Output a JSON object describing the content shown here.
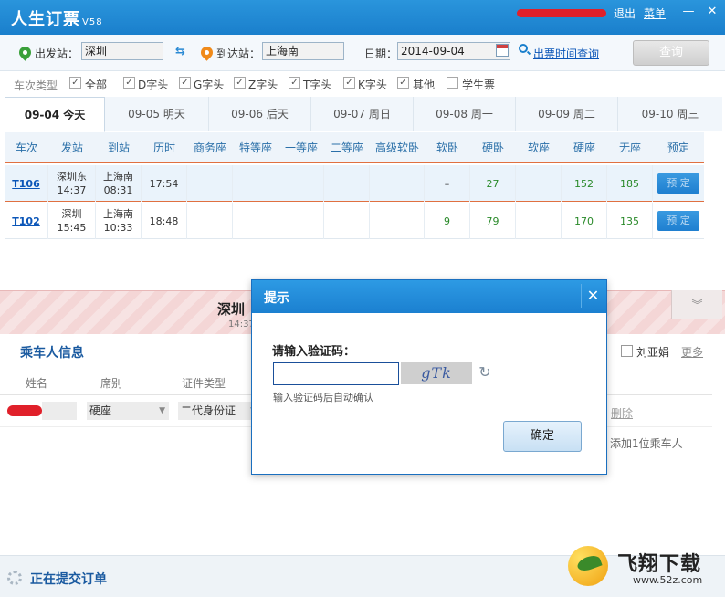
{
  "window": {
    "title": "人生订票",
    "version": "V58",
    "logout_label": "退出",
    "menu_label": "菜单",
    "minimize_glyph": "—",
    "close_glyph": "✕"
  },
  "search": {
    "from_label": "出发站：",
    "from_value": "深圳",
    "swap_glyph": "⇆",
    "to_label": "到达站：",
    "to_value": "上海南",
    "date_label": "日期：",
    "date_value": "2014-09-04",
    "schedule_link": "出票时间查询",
    "query_button": "查询"
  },
  "filters": {
    "label": "车次类型",
    "options": [
      {
        "label": "全部",
        "checked": true
      },
      {
        "label": "D字头",
        "checked": true
      },
      {
        "label": "G字头",
        "checked": true
      },
      {
        "label": "Z字头",
        "checked": true
      },
      {
        "label": "T字头",
        "checked": true
      },
      {
        "label": "K字头",
        "checked": true
      },
      {
        "label": "其他",
        "checked": true
      },
      {
        "label": "学生票",
        "checked": false
      }
    ],
    "check_glyph": "✓"
  },
  "date_tabs": [
    {
      "label": "09-04  今天",
      "active": true
    },
    {
      "label": "09-05  明天",
      "active": false
    },
    {
      "label": "09-06  后天",
      "active": false
    },
    {
      "label": "09-07  周日",
      "active": false
    },
    {
      "label": "09-08  周一",
      "active": false
    },
    {
      "label": "09-09  周二",
      "active": false
    },
    {
      "label": "09-10  周三",
      "active": false
    }
  ],
  "table": {
    "headers": [
      "车次",
      "发站",
      "到站",
      "历时",
      "商务座",
      "特等座",
      "一等座",
      "二等座",
      "高级软卧",
      "软卧",
      "硬卧",
      "软座",
      "硬座",
      "无座",
      "预定"
    ],
    "rows": [
      {
        "train": "T106",
        "from_station": "深圳东",
        "from_time": "14:37",
        "to_station": "上海南",
        "to_time": "08:31",
        "duration": "17:54",
        "business": "",
        "special": "",
        "first": "",
        "second": "",
        "adv_soft_sleeper": "",
        "soft_sleeper": "–",
        "hard_sleeper": "27",
        "soft_seat": "",
        "hard_seat": "152",
        "no_seat": "185",
        "book": "预 定"
      },
      {
        "train": "T102",
        "from_station": "深圳",
        "from_time": "15:45",
        "to_station": "上海南",
        "to_time": "10:33",
        "duration": "18:48",
        "business": "",
        "special": "",
        "first": "",
        "second": "",
        "adv_soft_sleeper": "",
        "soft_sleeper": "9",
        "hard_sleeper": "79",
        "soft_seat": "",
        "hard_seat": "170",
        "no_seat": "135",
        "book": "预 定"
      }
    ]
  },
  "order_panel": {
    "station_text": "深圳",
    "time_text": "14:37",
    "collapse_glyph": "︾",
    "passenger_title": "乘车人信息",
    "saved_passenger": "刘亚娟",
    "more_link": "更多",
    "col_name": "姓名",
    "col_seat": "席别",
    "col_id_type": "证件类型",
    "seat_value": "硬座",
    "id_type_value": "二代身份证",
    "dropdown_glyph": "▼",
    "delete_link": "删除",
    "add_passenger": "添加1位乘车人"
  },
  "status": {
    "text": "正在提交订单"
  },
  "watermark": {
    "brand": "飞翔下载",
    "url": "www.52z.com"
  },
  "dialog": {
    "title": "提示",
    "close_glyph": "✕",
    "prompt": "请输入验证码：",
    "captcha_text": "gTk",
    "refresh_glyph": "↻",
    "hint": "输入验证码后自动确认",
    "ok_button": "确定"
  }
}
